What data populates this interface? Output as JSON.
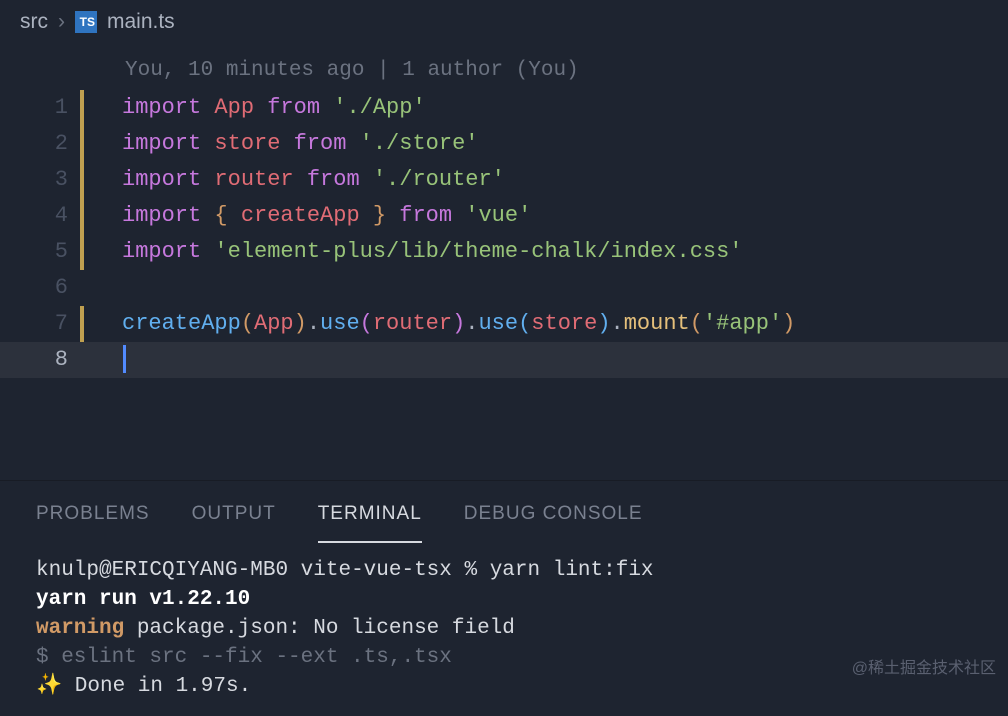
{
  "breadcrumb": {
    "folder": "src",
    "file": "main.ts"
  },
  "blame": "You, 10 minutes ago | 1 author (You)",
  "code": {
    "line1": {
      "import": "import",
      "var": "App",
      "from": "from",
      "str": "'./App'"
    },
    "line2": {
      "import": "import",
      "var": "store",
      "from": "from",
      "str": "'./store'"
    },
    "line3": {
      "import": "import",
      "var": "router",
      "from": "from",
      "str": "'./router'"
    },
    "line4": {
      "import": "import",
      "lbrace": "{",
      "var": "createApp",
      "rbrace": "}",
      "from": "from",
      "str": "'vue'"
    },
    "line5": {
      "import": "import",
      "str": "'element-plus/lib/theme-chalk/index.css'"
    },
    "line7": {
      "fn1": "createApp",
      "arg1": "App",
      "use1": "use",
      "arg2": "router",
      "use2": "use",
      "arg3": "store",
      "mount": "mount",
      "str": "'#app'"
    }
  },
  "lineNumbers": {
    "l1": "1",
    "l2": "2",
    "l3": "3",
    "l4": "4",
    "l5": "5",
    "l6": "6",
    "l7": "7",
    "l8": "8"
  },
  "panel": {
    "tabs": {
      "problems": "PROBLEMS",
      "output": "OUTPUT",
      "terminal": "TERMINAL",
      "debug": "DEBUG CONSOLE"
    }
  },
  "terminal": {
    "line1_user": "knulp@ERICQIYANG-MB0",
    "line1_cwd": "vite-vue-tsx",
    "line1_cmd": "yarn lint:fix",
    "line2": "yarn run v1.22.10",
    "line3_warn": "warning",
    "line3_msg": " package.json: No license field",
    "line4": "$ eslint src --fix --ext .ts,.tsx",
    "line5_spark": "✨",
    "line5_msg": "  Done in 1.97s."
  },
  "watermark": "@稀土掘金技术社区"
}
